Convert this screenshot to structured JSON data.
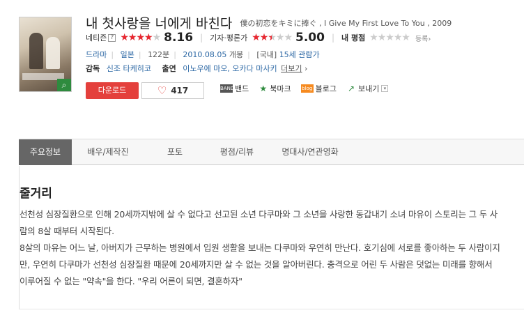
{
  "movie": {
    "title": "내 첫사랑을 너에게 바친다",
    "subtitle": "僕の初恋をキミに捧ぐ , I Give My First Love To You , 2009",
    "netizen_label": "네티즌",
    "netizen_help": "?",
    "netizen_score": "8.16",
    "netizen_fraction": 0.816,
    "critic_label": "기자·평론가",
    "critic_score": "5.00",
    "critic_fraction": 0.5,
    "my_label": "내 평점",
    "my_fraction": 0,
    "register_label": "등록›",
    "genre": "드라마",
    "country": "일본",
    "runtime": "122분",
    "release_date": "2010.08.05",
    "release_suffix": "개봉",
    "region": "[국내]",
    "age_rating": "15세 관람가",
    "director_label": "감독",
    "director": "신조 타케히코",
    "cast_label": "출연",
    "cast": "이노우에 마오, 오카다 마사키",
    "more_label": "더보기",
    "more_arrow": "›"
  },
  "actions": {
    "download_label": "다운로드",
    "like_count": "417",
    "share_items": [
      {
        "label": "밴드",
        "icon": "band-icon",
        "glyph": "BAND"
      },
      {
        "label": "북마크",
        "icon": "bookmark-star-icon",
        "glyph": "★"
      },
      {
        "label": "블로그",
        "icon": "blog-icon",
        "glyph": "blog"
      },
      {
        "label": "보내기",
        "icon": "send-icon",
        "glyph": "↗"
      }
    ],
    "dropdown_glyph": "▾"
  },
  "tabs": [
    {
      "label": "주요정보",
      "active": true
    },
    {
      "label": "배우/제작진",
      "active": false
    },
    {
      "label": "포토",
      "active": false
    },
    {
      "label": "평점/리뷰",
      "active": false
    },
    {
      "label": "명대사/연관영화",
      "active": false
    }
  ],
  "synopsis": {
    "title": "줄거리",
    "paragraphs": [
      "선천성 심장질환으로 인해 20세까지밖에 살 수 없다고 선고된 소년 다쿠마와 그 소년을 사랑한 동갑내기 소녀 마유이 스토리는 그 두 사람의 8살 때부터 시작된다.",
      " 8살의 마유는 어느 날, 아버지가 근무하는 병원에서 입원 생활을 보내는 다쿠마와 우연히 만난다. 호기심에 서로를 좋아하는 두 사람이지만, 우연히 다쿠마가 선천성 심장질환 때문에 20세까지만 살 수 없는 것을 알아버린다. 충격으로 어린 두 사람은 덧없는 미래를 향해서 이루어질 수 없는 \"약속\"을 한다. \"우리 어른이 되면, 결혼하자\""
    ]
  },
  "colors": {
    "accent_red": "#e4403c",
    "star_red": "#e8262f",
    "link_blue": "#2a66a3",
    "tab_active": "#666666"
  }
}
